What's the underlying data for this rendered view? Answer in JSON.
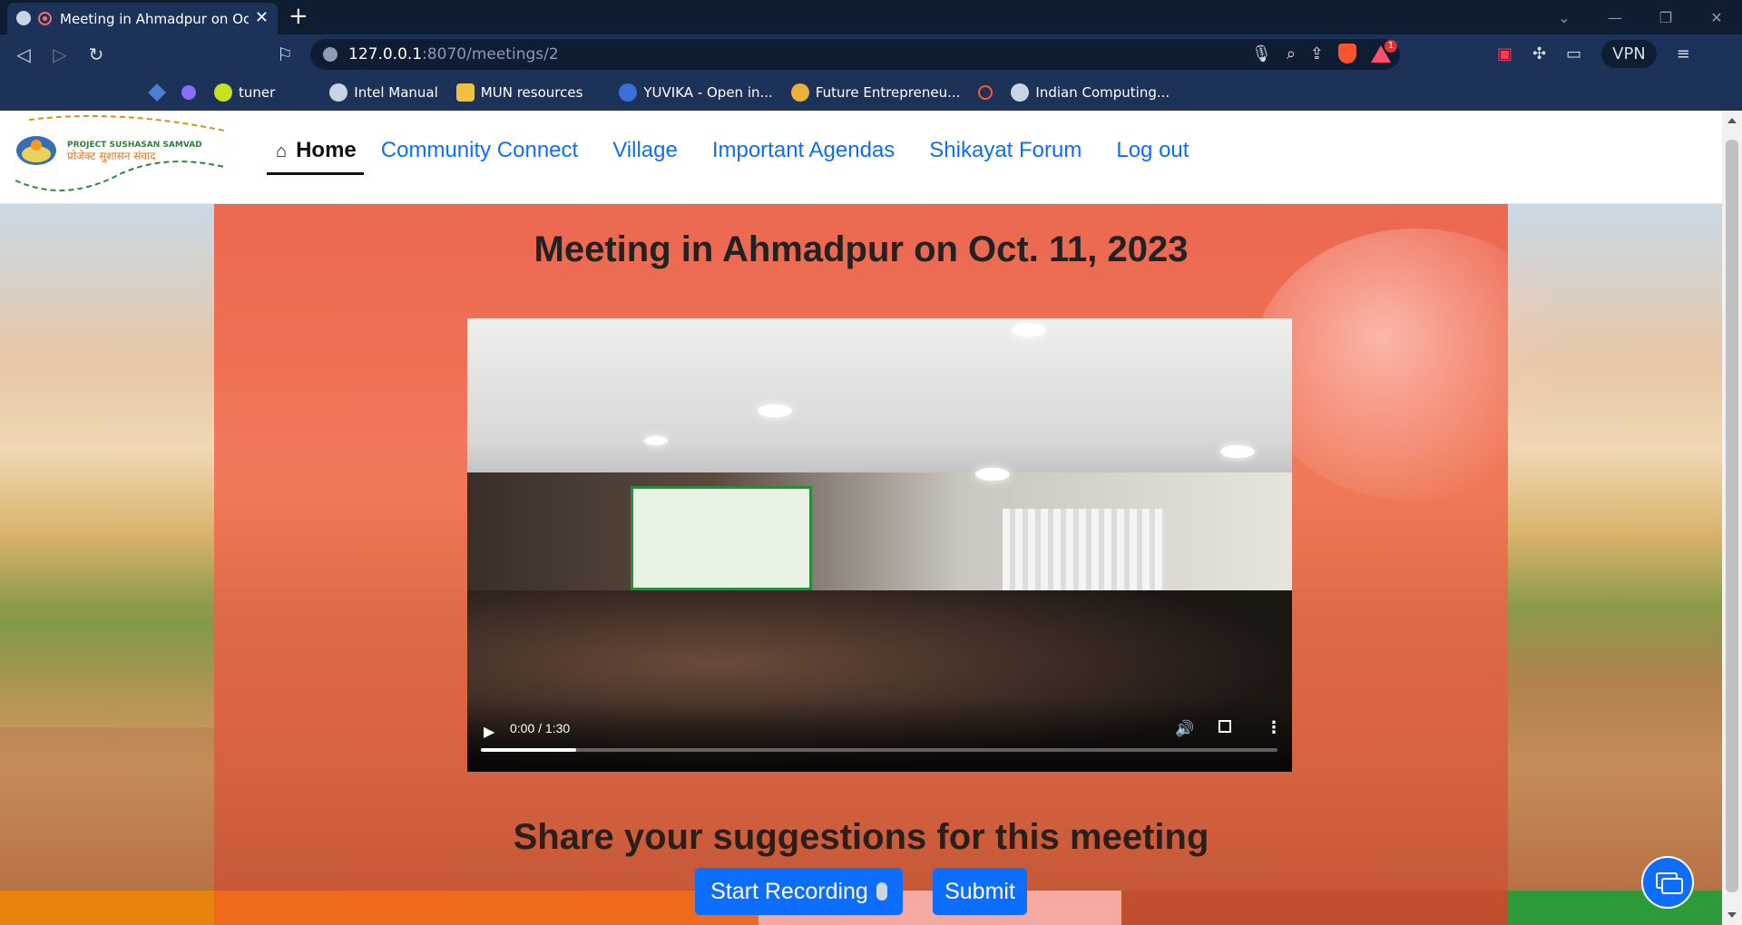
{
  "browser": {
    "tab_title": "Meeting in Ahmadpur on Oct. 11, 2023",
    "close_tab": "✕",
    "new_tab": "+",
    "url_host": "127.0.0.1",
    "url_rest": ":8070/meetings/2",
    "vpn_label": "VPN",
    "bookmarks": [
      {
        "label": "tuner",
        "color": "#c7e022"
      },
      {
        "label": "Intel Manual",
        "color": "#c9d4e4"
      },
      {
        "label": "MUN resources",
        "color": "#f0c040"
      },
      {
        "label": "YUVIKA - Open in...",
        "color": "#3d6fd8"
      },
      {
        "label": "Future Entrepreneu...",
        "color": "#e9b23a"
      },
      {
        "label": "Indian Computing...",
        "color": "#c9d4e4"
      }
    ]
  },
  "site": {
    "logo_text_top": "PROJECT SUSHASAN SAMVAD",
    "logo_text_bottom": "प्रोजेक्ट सुशासन संवाद",
    "nav": {
      "home": "Home",
      "community": "Community Connect",
      "village": "Village",
      "agendas": "Important Agendas",
      "shikayat": "Shikayat Forum",
      "logout": "Log out"
    },
    "meeting_title": "Meeting in Ahmadpur on Oct. 11, 2023",
    "video": {
      "time": "0:00 / 1:30",
      "progress_fraction": 0.12
    },
    "suggest_heading": "Share your suggestions for this meeting",
    "record_button": "Start Recording",
    "submit_button": "Submit"
  },
  "colors": {
    "primary": "#0d6efd",
    "browser_dark": "#0f1d33",
    "browser_toolbar": "#1c3258",
    "overlay": "#ee5e44"
  }
}
